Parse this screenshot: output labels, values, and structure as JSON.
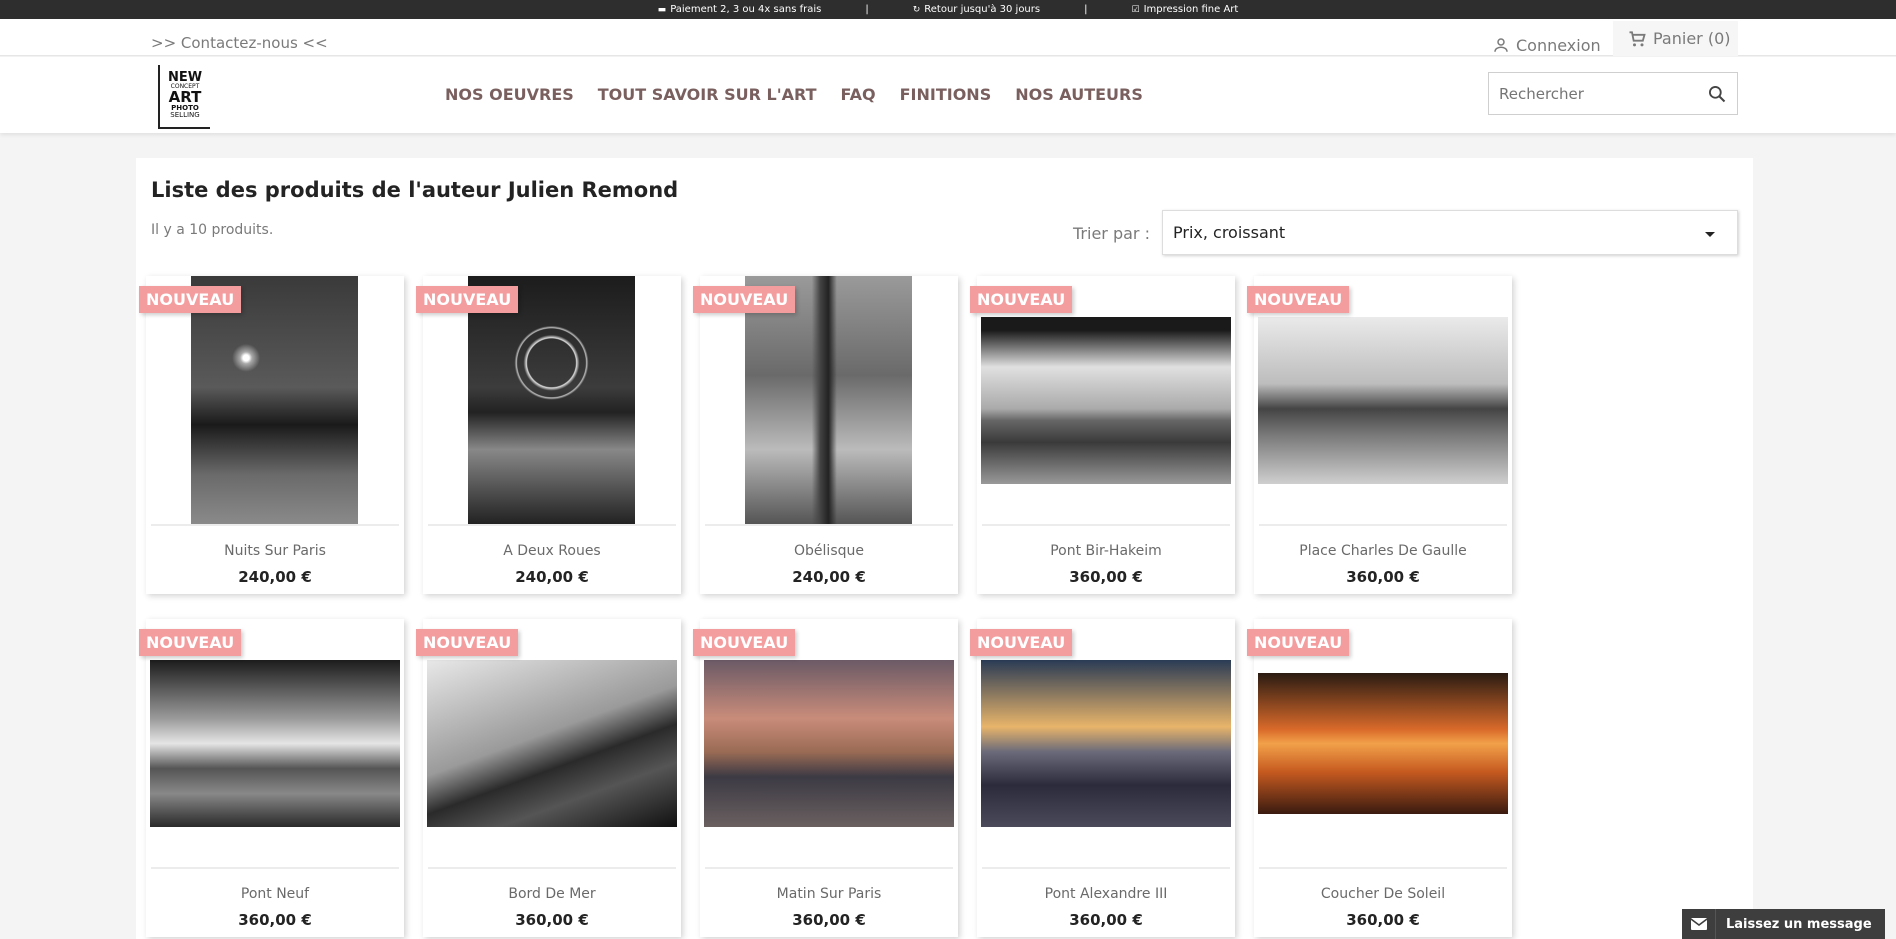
{
  "topbar": {
    "items": [
      {
        "icon": "credit-card-icon",
        "text": "Paiement 2, 3 ou 4x sans frais"
      },
      {
        "icon": "return-icon",
        "text": "Retour jusqu'à 30 jours"
      },
      {
        "icon": "check-square-icon",
        "text": "Impression fine Art"
      }
    ],
    "separator": "|"
  },
  "header": {
    "contact": ">> Contactez-nous <<",
    "connexion": "Connexion",
    "cart": "Panier (0)",
    "logo": {
      "line1": "NEW",
      "line2": "CONCEPT",
      "line3": "ART",
      "line4": "PHOTO",
      "line5": "SELLING"
    },
    "nav": [
      "NOS OEUVRES",
      "TOUT SAVOIR SUR L'ART",
      "FAQ",
      "FINITIONS",
      "NOS AUTEURS"
    ],
    "search_placeholder": "Rechercher"
  },
  "listing": {
    "title": "Liste des produits de l'auteur Julien Remond",
    "count": "Il y a 10 produits.",
    "sort_label": "Trier par :",
    "sort_value": "Prix, croissant"
  },
  "badge_label": "NOUVEAU",
  "products": [
    {
      "name": "Nuits Sur Paris",
      "price": "240,00 €"
    },
    {
      "name": "A Deux Roues",
      "price": "240,00 €"
    },
    {
      "name": "Obélisque",
      "price": "240,00 €"
    },
    {
      "name": "Pont Bir-Hakeim",
      "price": "360,00 €"
    },
    {
      "name": "Place Charles De Gaulle",
      "price": "360,00 €"
    },
    {
      "name": "Pont Neuf",
      "price": "360,00 €"
    },
    {
      "name": "Bord De Mer",
      "price": "360,00 €"
    },
    {
      "name": "Matin Sur Paris",
      "price": "360,00 €"
    },
    {
      "name": "Pont Alexandre III",
      "price": "360,00 €"
    },
    {
      "name": "Coucher De Soleil",
      "price": "360,00 €"
    }
  ],
  "chat": {
    "label": "Laissez un message"
  },
  "colors": {
    "badge": "#f39d9f",
    "nav": "#7a5f5f",
    "topbar": "#2e2e2e"
  }
}
